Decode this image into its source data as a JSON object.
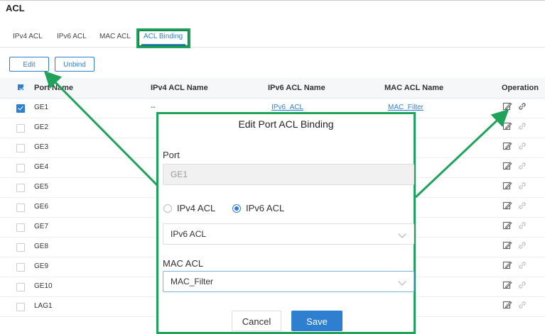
{
  "page": {
    "title": "ACL"
  },
  "tabs": [
    {
      "label": "IPv4 ACL"
    },
    {
      "label": "IPv6 ACL"
    },
    {
      "label": "MAC ACL"
    },
    {
      "label": "ACL Binding",
      "active": true
    }
  ],
  "toolbar": {
    "edit_label": "Edit",
    "unbind_label": "Unbind"
  },
  "table": {
    "headers": [
      "Port Name",
      "IPv4 ACL Name",
      "IPv6 ACL Name",
      "MAC ACL Name",
      "Operation"
    ],
    "rows": [
      {
        "port": "GE1",
        "ipv4": "--",
        "ipv6": "IPv6_ACL",
        "mac": "MAC_Filter",
        "checked": true
      },
      {
        "port": "GE2"
      },
      {
        "port": "GE3"
      },
      {
        "port": "GE4"
      },
      {
        "port": "GE5"
      },
      {
        "port": "GE6"
      },
      {
        "port": "GE7"
      },
      {
        "port": "GE8"
      },
      {
        "port": "GE9"
      },
      {
        "port": "GE10"
      },
      {
        "port": "LAG1"
      }
    ]
  },
  "modal": {
    "title": "Edit Port ACL Binding",
    "port_label": "Port",
    "port_value": "GE1",
    "radio_ipv4": "IPv4 ACL",
    "radio_ipv6": "IPv6 ACL",
    "acl_select_value": "IPv6 ACL",
    "mac_label": "MAC ACL",
    "mac_select_value": "MAC_Filter",
    "cancel_label": "Cancel",
    "save_label": "Save"
  },
  "colors": {
    "accent": "#2f7fd1",
    "highlight": "#1fa35a"
  }
}
